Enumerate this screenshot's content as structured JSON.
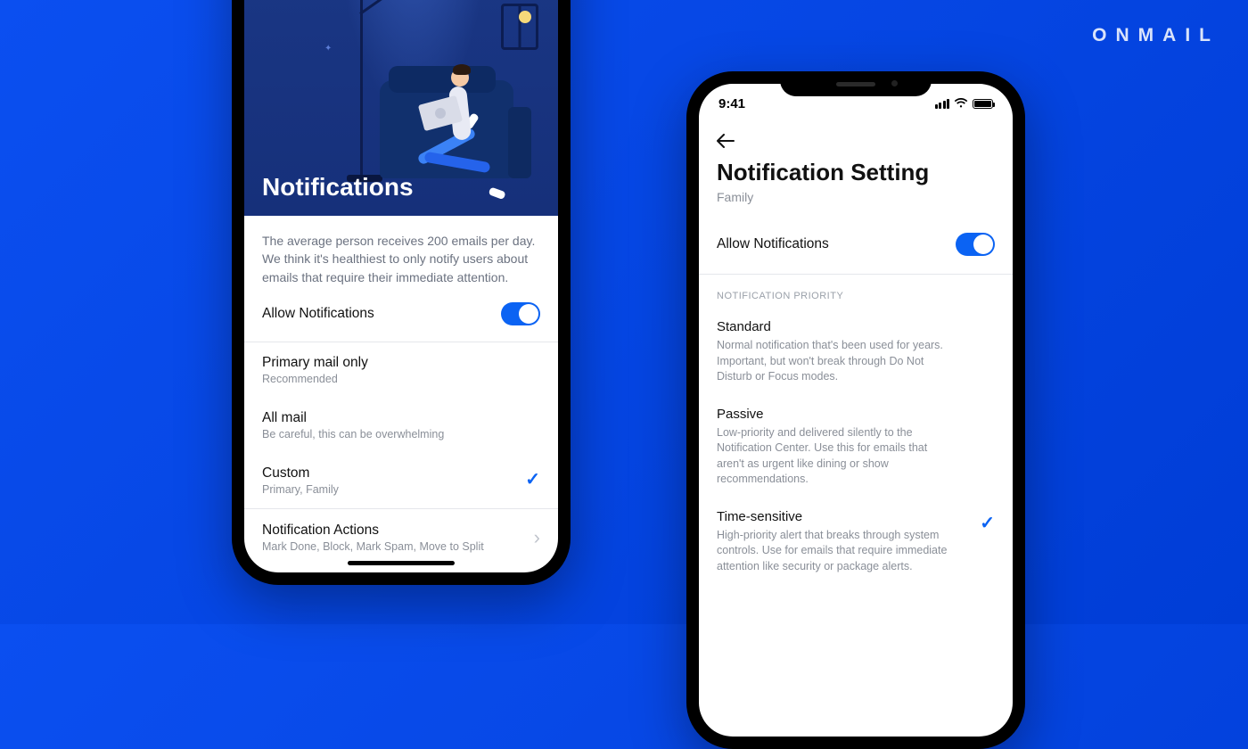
{
  "brand": "ONMAIL",
  "leftPhone": {
    "heroTitle": "Notifications",
    "description": "The average person receives 200 emails per day. We think it's healthiest to only notify users about emails that require their immediate attention.",
    "allowLabel": "Allow Notifications",
    "options": [
      {
        "title": "Primary mail only",
        "sub": "Recommended",
        "checked": false
      },
      {
        "title": "All mail",
        "sub": "Be careful, this can be overwhelming",
        "checked": false
      },
      {
        "title": "Custom",
        "sub": "Primary, Family",
        "checked": true
      }
    ],
    "actions": {
      "title": "Notification Actions",
      "sub": "Mark Done, Block, Mark Spam, Move to Split"
    }
  },
  "rightPhone": {
    "time": "9:41",
    "title": "Notification Setting",
    "subtitle": "Family",
    "allowLabel": "Allow Notifications",
    "sectionLabel": "NOTIFICATION PRIORITY",
    "priorities": [
      {
        "title": "Standard",
        "desc": "Normal notification that's been used for years. Important, but won't break through Do Not Disturb or Focus modes.",
        "checked": false
      },
      {
        "title": "Passive",
        "desc": "Low-priority and delivered silently to the Notification Center. Use this for emails that aren't as urgent like dining or show recommendations.",
        "checked": false
      },
      {
        "title": "Time-sensitive",
        "desc": "High-priority alert that breaks through system controls. Use for emails that require immediate attention like security or package alerts.",
        "checked": true
      }
    ]
  },
  "colors": {
    "accent": "#0b63f3"
  }
}
